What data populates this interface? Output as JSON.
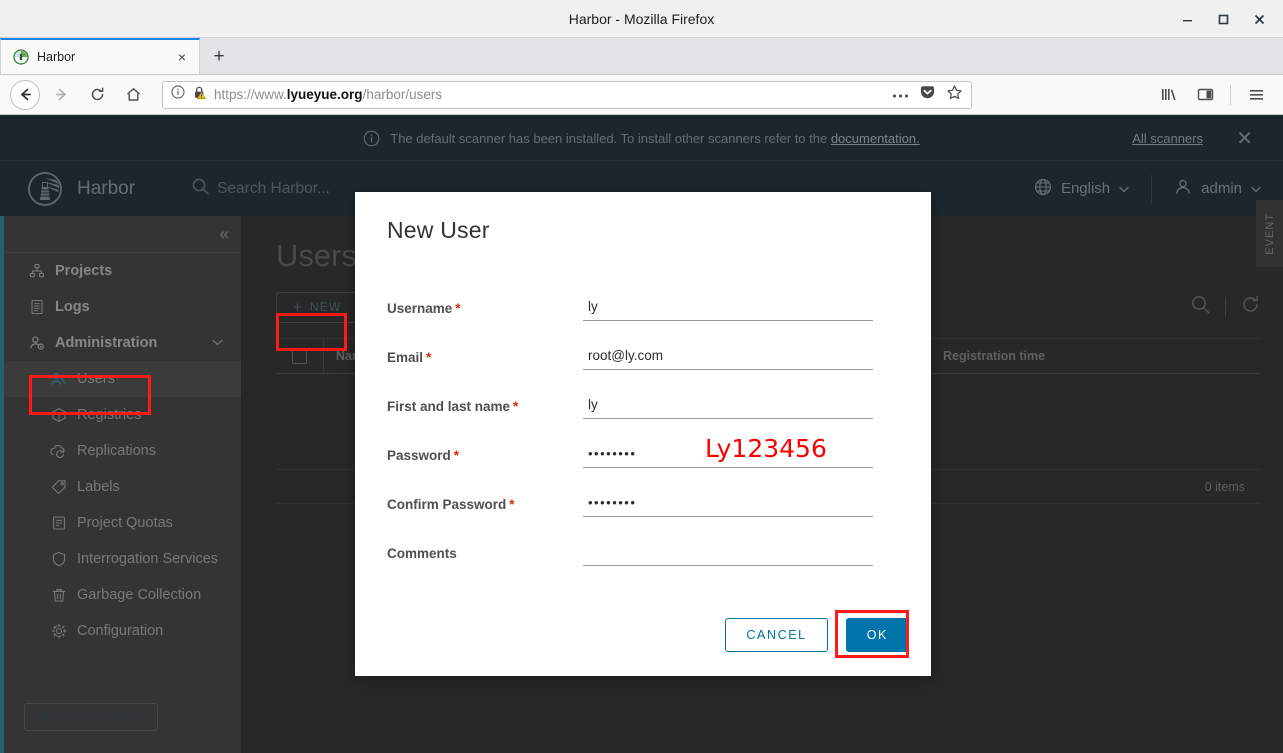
{
  "browser": {
    "window_title": "Harbor - Mozilla Firefox",
    "tab": {
      "label": "Harbor",
      "close_label": "×"
    },
    "new_tab_label": "+",
    "window_controls": {
      "minimize": "—",
      "maximize": "□",
      "close": "✕"
    },
    "url": {
      "scheme": "https://www.",
      "domain": "lyueyue.org",
      "path": "/harbor/users"
    },
    "nav": {
      "back": "←",
      "forward": "→",
      "reload": "↻",
      "home": "⌂"
    },
    "urlbar_icons": [
      "info-icon",
      "warning-lock-icon",
      "page-actions-icon",
      "pocket-icon",
      "bookmark-star-icon"
    ],
    "toolbar_icons": [
      "library-icon",
      "sidebar-icon",
      "hamburger-menu-icon"
    ]
  },
  "notification": {
    "message": "The default scanner has been installed. To install other scanners refer to the ",
    "link": "documentation.",
    "all_scanners": "All scanners",
    "close": "✕"
  },
  "header": {
    "brand": "Harbor",
    "search_placeholder": "Search Harbor...",
    "language": "English",
    "user": "admin",
    "caret": "⌄"
  },
  "event_tab": {
    "label": "EVENT"
  },
  "sidebar": {
    "collapse_icon": "«",
    "items": [
      {
        "label": "Projects",
        "icon": "projects-icon",
        "level": "top"
      },
      {
        "label": "Logs",
        "icon": "logs-icon",
        "level": "top"
      },
      {
        "label": "Administration",
        "icon": "administration-icon",
        "level": "top",
        "expanded": true
      },
      {
        "label": "Users",
        "icon": "users-icon",
        "level": "sub",
        "active": true
      },
      {
        "label": "Registries",
        "icon": "registries-icon",
        "level": "sub"
      },
      {
        "label": "Replications",
        "icon": "replications-icon",
        "level": "sub"
      },
      {
        "label": "Labels",
        "icon": "labels-icon",
        "level": "sub"
      },
      {
        "label": "Project Quotas",
        "icon": "quotas-icon",
        "level": "sub"
      },
      {
        "label": "Interrogation Services",
        "icon": "shield-icon",
        "level": "sub"
      },
      {
        "label": "Garbage Collection",
        "icon": "trash-icon",
        "level": "sub"
      },
      {
        "label": "Configuration",
        "icon": "gear-icon",
        "level": "sub"
      }
    ],
    "api_explorer": "API EXPLORER"
  },
  "main": {
    "page_title": "Users",
    "new_button": "NEW",
    "new_button_plus": "+",
    "columns": [
      "Name",
      "Registration time"
    ],
    "items_count": "0 items"
  },
  "modal": {
    "title": "New User",
    "fields": [
      {
        "label": "Username",
        "required": true,
        "value": "ly",
        "type": "text"
      },
      {
        "label": "Email",
        "required": true,
        "value": "root@ly.com",
        "type": "text"
      },
      {
        "label": "First and last name",
        "required": true,
        "value": "ly",
        "type": "text"
      },
      {
        "label": "Password",
        "required": true,
        "value": "••••••••",
        "type": "password",
        "annotation": "Ly123456"
      },
      {
        "label": "Confirm Password",
        "required": true,
        "value": "••••••••",
        "type": "password"
      },
      {
        "label": "Comments",
        "required": false,
        "value": "",
        "type": "text"
      }
    ],
    "cancel_label": "CANCEL",
    "ok_label": "OK",
    "required_mark": "*"
  },
  "colors": {
    "primary_blue": "#0075ab",
    "annotation_red": "#ff1a1a",
    "harbor_header": "#2b3b44",
    "sidebar": "#4e4e4e",
    "required_asterisk": "#e02200"
  }
}
